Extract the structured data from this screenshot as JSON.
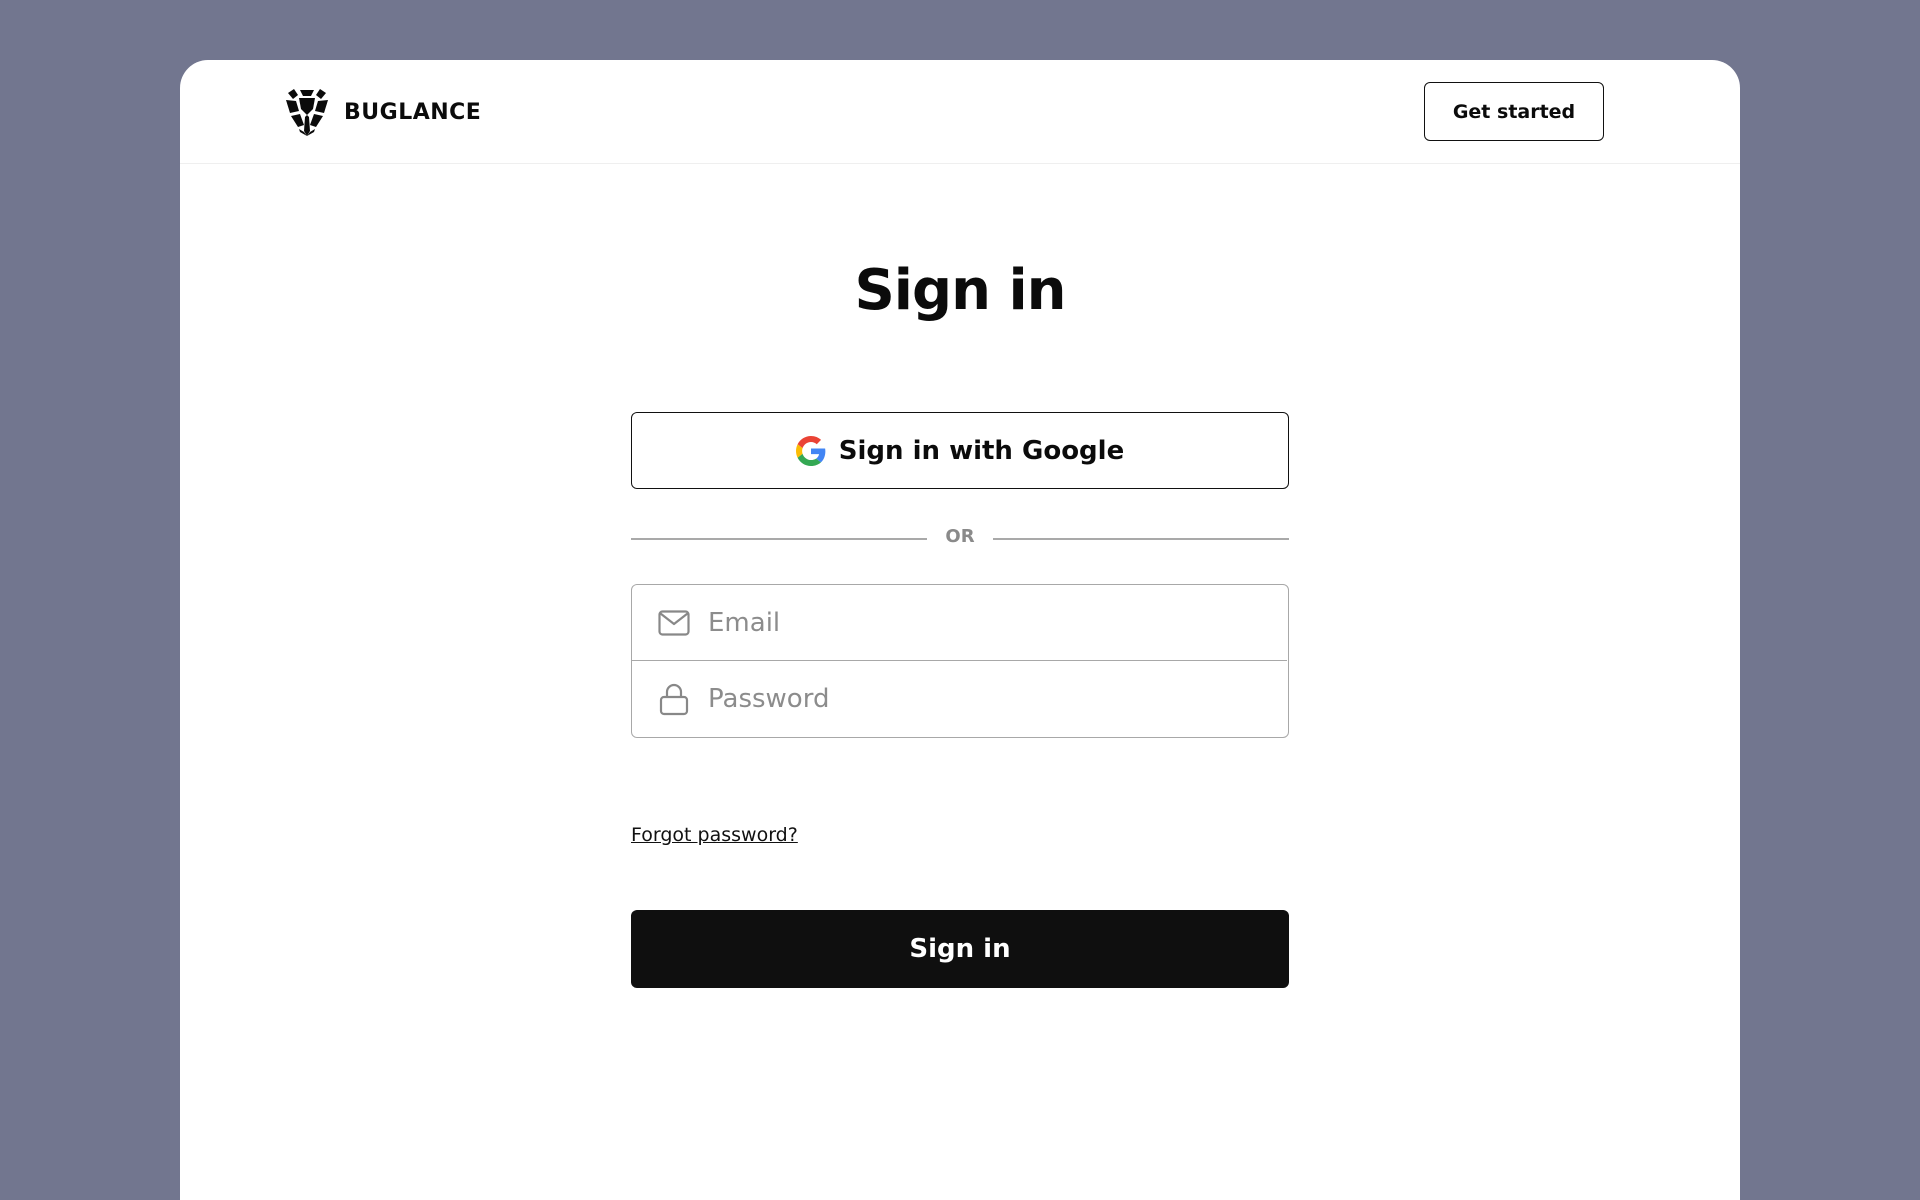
{
  "header": {
    "brand_name": "BUGLANCE",
    "logo_icon": "shield-bug-logo",
    "get_started_label": "Get started"
  },
  "main": {
    "title": "Sign in",
    "google_button": {
      "label": "Sign in with Google",
      "icon": "google-icon",
      "icon_colors": [
        "#4285F4",
        "#34A853",
        "#FBBC05",
        "#EA4335"
      ]
    },
    "divider_label": "OR",
    "email": {
      "placeholder": "Email",
      "value": "",
      "icon": "mail-icon"
    },
    "password": {
      "placeholder": "Password",
      "value": "",
      "icon": "lock-icon"
    },
    "forgot_password_label": "Forgot password?",
    "submit_label": "Sign in"
  },
  "colors": {
    "background": "#72768f",
    "card": "#ffffff",
    "primary_button": "#0f0f0f",
    "text": "#0b0b0b",
    "muted": "#8c8c8c"
  }
}
